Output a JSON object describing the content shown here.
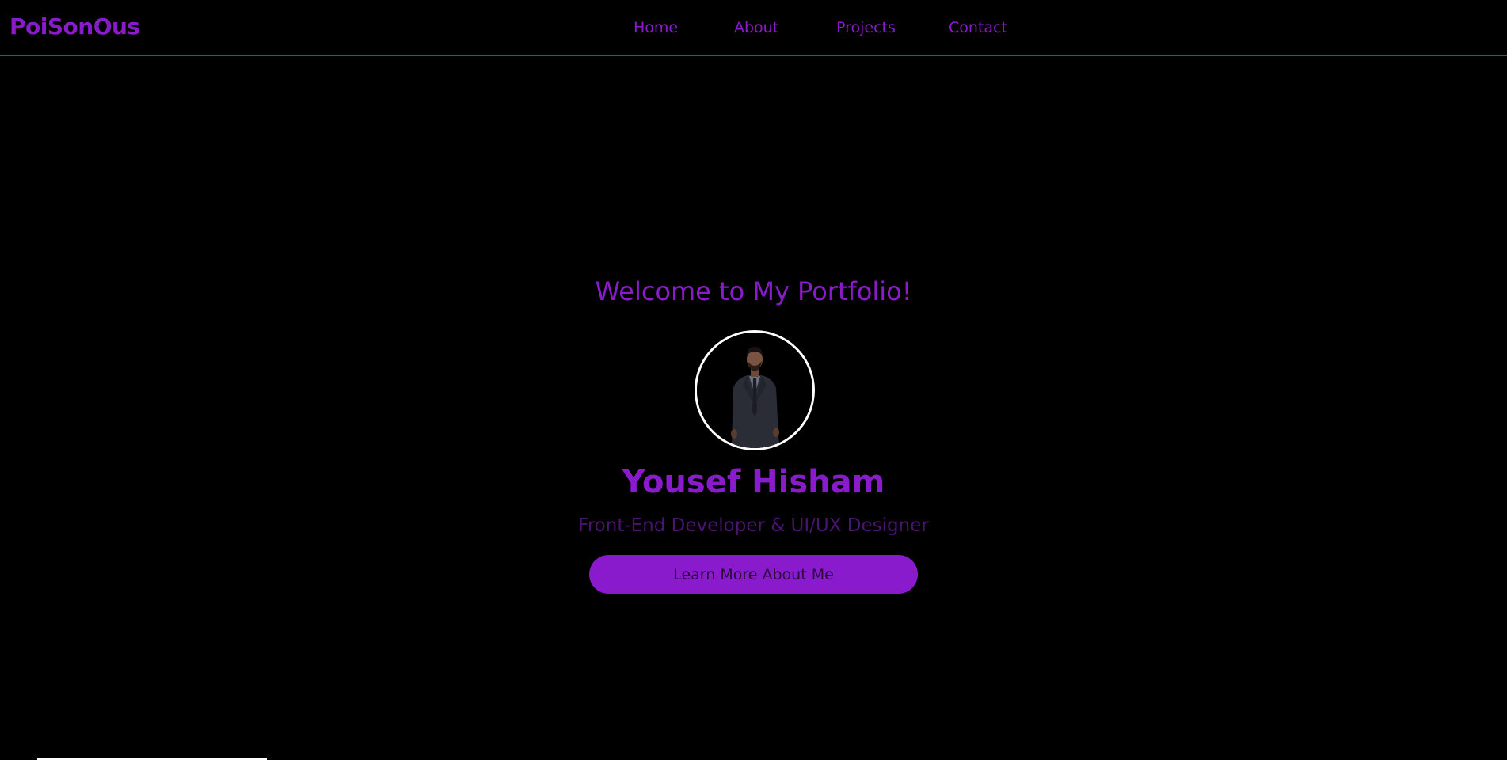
{
  "navbar": {
    "logo": "PoiSonOus",
    "links": [
      {
        "label": "Home"
      },
      {
        "label": "About"
      },
      {
        "label": "Projects"
      },
      {
        "label": "Contact"
      }
    ]
  },
  "hero": {
    "welcome": "Welcome to My Portfolio!",
    "name": "Yousef Hisham",
    "subtitle": "Front-End Developer & UI/UX Designer",
    "cta_label": "Learn More About Me"
  },
  "colors": {
    "background": "#000000",
    "accent": "#8a1bcc",
    "subtitle": "#4a1470",
    "avatar_border": "#ffffff"
  }
}
